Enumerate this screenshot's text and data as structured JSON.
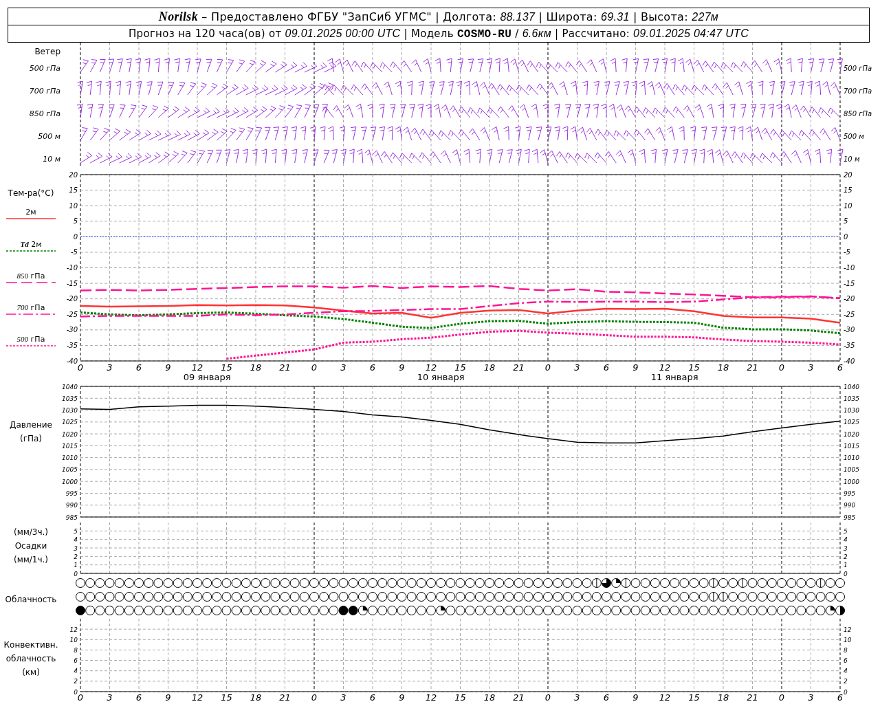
{
  "header": {
    "line_1": "**Norilsk** – Предоставлено ФГБУ \"ЗапСиб УГМС\" | Долгота: *88.137* | Широта: *69.31* | Высота: *227м*",
    "line_2": "Прогноз на 120 часа(ов) от *09.01.2025 00:00 UTC* | Модель **COSMO-RU** / *6.6км* | Рассчитано: *09.01.2025 04:47 UTC*"
  },
  "wind": {
    "title": "Ветер",
    "levels": [
      {
        "left": "500 гПа",
        "right": "500 гПа"
      },
      {
        "left": "700 гПа",
        "right": "700 гПа"
      },
      {
        "left": "850 гПа",
        "right": "850 гПа"
      },
      {
        "left": "500 м",
        "right": "500 м"
      },
      {
        "left": "10 м",
        "right": "10 м"
      }
    ]
  },
  "temperature": {
    "title": "Тем-ра(°C)",
    "dates": [
      "09 января",
      "10 января",
      "11 января"
    ],
    "right_ticks": [
      "20",
      "15",
      "10",
      "5",
      "0",
      "-5",
      "-10",
      "-15",
      "-20",
      "-25",
      "-30",
      "-35",
      "-40"
    ],
    "chart_data": {
      "type": "line",
      "categories": [
        "0",
        "3",
        "6",
        "9",
        "12",
        "15",
        "18",
        "21",
        "0",
        "3",
        "6",
        "9",
        "12",
        "15",
        "18",
        "21",
        "0",
        "3",
        "6",
        "9",
        "12",
        "15",
        "18",
        "21",
        "0",
        "3",
        "6"
      ],
      "ylim": [
        -40,
        20
      ],
      "yticks": [
        20,
        15,
        10,
        5,
        0,
        -5,
        -10,
        -15,
        -20,
        -25,
        -30,
        -35,
        -40
      ],
      "grid": true,
      "ref_lines": [
        {
          "axis": "y",
          "value": 0,
          "color": "#2040ff"
        }
      ],
      "series": [
        {
          "name": "2м",
          "line_style": "solid",
          "color": "#ff3333",
          "values": [
            -22.3,
            -22.5,
            -22.4,
            -22.3,
            -22,
            -22.1,
            -22,
            -22.1,
            -22.8,
            -23.8,
            -24.7,
            -24.5,
            -26.1,
            -24.5,
            -23.8,
            -23.6,
            -24.7,
            -23.8,
            -23.2,
            -23.3,
            -23.2,
            -24,
            -25.5,
            -26,
            -26,
            -26.4,
            -27.7
          ]
        },
        {
          "name": "**Td** 2м",
          "line_style": "dotted",
          "color": "#008000",
          "values": [
            -24.4,
            -25,
            -25.3,
            -25,
            -24.6,
            -24.4,
            -24.8,
            -25.3,
            -25.7,
            -26.5,
            -27.7,
            -29,
            -29.4,
            -28,
            -27.2,
            -27.1,
            -28,
            -27.5,
            -27.2,
            -27.4,
            -27.5,
            -27.7,
            -29.3,
            -29.8,
            -29.8,
            -30.2,
            -31.1
          ]
        },
        {
          "name": "*850* гПа",
          "line_style": "dashed",
          "color": "#ff1493",
          "values": [
            -17.3,
            -17.1,
            -17.3,
            -17.1,
            -16.8,
            -16.5,
            -16.2,
            -16,
            -16,
            -16.4,
            -15.9,
            -16.5,
            -16,
            -16.2,
            -15.9,
            -16.8,
            -17.3,
            -16.9,
            -17.7,
            -17.9,
            -18.3,
            -18.6,
            -19,
            -19.5,
            -19.3,
            -19.2,
            -19.8
          ]
        },
        {
          "name": "*700* гПа",
          "line_style": "dashdot",
          "color": "#ff1493",
          "values": [
            -25.7,
            -25.5,
            -25.5,
            -25.5,
            -25.5,
            -25,
            -25.3,
            -25,
            -24.5,
            -24,
            -23.9,
            -23.6,
            -23.3,
            -23.3,
            -22.3,
            -21.4,
            -20.9,
            -21,
            -20.9,
            -20.9,
            -21.1,
            -20.9,
            -20.2,
            -19.5,
            -19.5,
            -19.3,
            -19.8
          ]
        },
        {
          "name": "*500* гПа",
          "line_style": "dotted",
          "color": "#ff1493",
          "values": [
            null,
            null,
            null,
            null,
            null,
            -39.3,
            -38.3,
            -37.3,
            -36.3,
            -34.1,
            -33.8,
            -33,
            -32.5,
            -31.5,
            -30.6,
            -30.3,
            -30.9,
            -31.2,
            -31.7,
            -32.2,
            -32.2,
            -32.4,
            -33.1,
            -33.6,
            -33.8,
            -34.1,
            -34.7
          ]
        }
      ]
    }
  },
  "pressure": {
    "labels": [
      "Давление",
      "(гПа)"
    ],
    "right_ticks": [
      "1040",
      "1035",
      "1030",
      "1025",
      "1020",
      "1015",
      "1010",
      "1005",
      "1000",
      "995",
      "990",
      "985"
    ],
    "chart_data": {
      "type": "line",
      "categories": [
        null,
        null,
        null,
        null,
        null,
        null,
        null,
        null,
        null,
        null,
        null,
        null,
        null,
        null,
        null,
        null,
        null,
        null,
        null,
        null,
        null,
        null,
        null,
        null,
        null,
        null,
        null
      ],
      "ylim": [
        985,
        1040
      ],
      "yticks": [
        1040,
        1035,
        1030,
        1025,
        1020,
        1015,
        1010,
        1005,
        1000,
        995,
        990,
        985
      ],
      "grid": true,
      "series": [
        {
          "color": "#000000",
          "values": [
            1030.5,
            1030.3,
            1031.4,
            1031.7,
            1032,
            1032,
            1031.7,
            1031.1,
            1030.3,
            1029.4,
            1028,
            1027.1,
            1025.7,
            1024,
            1021.7,
            1019.7,
            1018,
            1016.5,
            1016.2,
            1016.2,
            1017.1,
            1018,
            1019.1,
            1020.9,
            1022.5,
            1024,
            1025.4
          ]
        }
      ]
    }
  },
  "precipitation": {
    "labels": [
      "(мм/3ч.)",
      "Осадки",
      "(мм/1ч.)"
    ],
    "right_ticks": [
      "5",
      "4",
      "3",
      "2",
      "1",
      "0"
    ],
    "chart_data": {
      "type": "bar",
      "categories": [
        null,
        null,
        null,
        null,
        null,
        null,
        null,
        null,
        null,
        null,
        null,
        null,
        null,
        null,
        null,
        null,
        null,
        null,
        null,
        null,
        null,
        null,
        null,
        null,
        null,
        null,
        null
      ],
      "ylim": [
        0,
        6
      ],
      "yticks": [
        5,
        4,
        3,
        2,
        1,
        0
      ],
      "grid": true,
      "values": [
        0,
        0,
        0,
        0,
        0,
        0,
        0,
        0,
        0,
        0,
        0,
        0,
        0,
        0,
        0,
        0,
        0,
        0,
        0,
        0,
        0,
        0,
        0,
        0,
        0,
        0,
        0
      ]
    }
  },
  "clouds": {
    "label": "Облачность",
    "rows": [
      {
        "cells": [
          {
            "kind": "clear"
          },
          {
            "kind": "clear"
          },
          {
            "kind": "clear"
          },
          {
            "kind": "clear"
          },
          {
            "kind": "clear"
          },
          {
            "kind": "clear"
          },
          {
            "kind": "clear"
          },
          {
            "kind": "clear"
          },
          {
            "kind": "clear"
          },
          {
            "kind": "clear"
          },
          {
            "kind": "clear"
          },
          {
            "kind": "clear"
          },
          {
            "kind": "clear"
          },
          {
            "kind": "clear"
          },
          {
            "kind": "clear"
          },
          {
            "kind": "clear"
          },
          {
            "kind": "clear"
          },
          {
            "kind": "clear"
          },
          {
            "kind": "clear"
          },
          {
            "kind": "clear"
          },
          {
            "kind": "clear"
          },
          {
            "kind": "clear"
          },
          {
            "kind": "clear"
          },
          {
            "kind": "clear"
          },
          {
            "kind": "clear"
          },
          {
            "kind": "clear"
          },
          {
            "kind": "clear"
          },
          {
            "kind": "clear"
          },
          {
            "kind": "clear"
          },
          {
            "kind": "clear"
          },
          {
            "kind": "clear"
          },
          {
            "kind": "clear"
          },
          {
            "kind": "clear"
          },
          {
            "kind": "clear"
          },
          {
            "kind": "clear"
          },
          {
            "kind": "clear"
          },
          {
            "kind": "clear"
          },
          {
            "kind": "clear"
          },
          {
            "kind": "clear"
          },
          {
            "kind": "clear"
          },
          {
            "kind": "clear"
          },
          {
            "kind": "clear"
          },
          {
            "kind": "clear"
          },
          {
            "kind": "clear"
          },
          {
            "kind": "clear"
          },
          {
            "kind": "clear"
          },
          {
            "kind": "clear"
          },
          {
            "kind": "clear"
          },
          {
            "kind": "clear"
          },
          {
            "kind": "clear"
          },
          {
            "kind": "clear"
          },
          {
            "kind": "clear"
          },
          {
            "kind": "clear"
          },
          {
            "kind": "trace"
          },
          {
            "kind": "three_quarters"
          },
          {
            "kind": "quarter"
          },
          {
            "kind": "trace"
          },
          {
            "kind": "clear"
          },
          {
            "kind": "clear"
          },
          {
            "kind": "clear"
          },
          {
            "kind": "clear"
          },
          {
            "kind": "clear"
          },
          {
            "kind": "clear"
          },
          {
            "kind": "clear"
          },
          {
            "kind": "clear"
          },
          {
            "kind": "trace"
          },
          {
            "kind": "clear"
          },
          {
            "kind": "clear"
          },
          {
            "kind": "trace"
          },
          {
            "kind": "clear"
          },
          {
            "kind": "clear"
          },
          {
            "kind": "clear"
          },
          {
            "kind": "clear"
          },
          {
            "kind": "clear"
          },
          {
            "kind": "clear"
          },
          {
            "kind": "clear"
          },
          {
            "kind": "trace"
          },
          {
            "kind": "clear"
          },
          {
            "kind": "clear"
          }
        ]
      },
      {
        "cells": [
          {
            "kind": "clear"
          },
          {
            "kind": "clear"
          },
          {
            "kind": "clear"
          },
          {
            "kind": "clear"
          },
          {
            "kind": "clear"
          },
          {
            "kind": "clear"
          },
          {
            "kind": "clear"
          },
          {
            "kind": "clear"
          },
          {
            "kind": "clear"
          },
          {
            "kind": "clear"
          },
          {
            "kind": "clear"
          },
          {
            "kind": "clear"
          },
          {
            "kind": "clear"
          },
          {
            "kind": "clear"
          },
          {
            "kind": "clear"
          },
          {
            "kind": "clear"
          },
          {
            "kind": "clear"
          },
          {
            "kind": "clear"
          },
          {
            "kind": "clear"
          },
          {
            "kind": "clear"
          },
          {
            "kind": "clear"
          },
          {
            "kind": "clear"
          },
          {
            "kind": "clear"
          },
          {
            "kind": "clear"
          },
          {
            "kind": "clear"
          },
          {
            "kind": "clear"
          },
          {
            "kind": "clear"
          },
          {
            "kind": "clear"
          },
          {
            "kind": "clear"
          },
          {
            "kind": "clear"
          },
          {
            "kind": "clear"
          },
          {
            "kind": "clear"
          },
          {
            "kind": "clear"
          },
          {
            "kind": "clear"
          },
          {
            "kind": "clear"
          },
          {
            "kind": "clear"
          },
          {
            "kind": "clear"
          },
          {
            "kind": "clear"
          },
          {
            "kind": "clear"
          },
          {
            "kind": "clear"
          },
          {
            "kind": "clear"
          },
          {
            "kind": "clear"
          },
          {
            "kind": "clear"
          },
          {
            "kind": "clear"
          },
          {
            "kind": "clear"
          },
          {
            "kind": "clear"
          },
          {
            "kind": "clear"
          },
          {
            "kind": "clear"
          },
          {
            "kind": "clear"
          },
          {
            "kind": "clear"
          },
          {
            "kind": "clear"
          },
          {
            "kind": "clear"
          },
          {
            "kind": "clear"
          },
          {
            "kind": "clear"
          },
          {
            "kind": "clear"
          },
          {
            "kind": "clear"
          },
          {
            "kind": "clear"
          },
          {
            "kind": "clear"
          },
          {
            "kind": "clear"
          },
          {
            "kind": "clear"
          },
          {
            "kind": "clear"
          },
          {
            "kind": "clear"
          },
          {
            "kind": "clear"
          },
          {
            "kind": "clear"
          },
          {
            "kind": "clear"
          },
          {
            "kind": "trace"
          },
          {
            "kind": "trace"
          },
          {
            "kind": "clear"
          },
          {
            "kind": "clear"
          },
          {
            "kind": "clear"
          },
          {
            "kind": "clear"
          },
          {
            "kind": "clear"
          },
          {
            "kind": "clear"
          },
          {
            "kind": "clear"
          },
          {
            "kind": "clear"
          },
          {
            "kind": "clear"
          },
          {
            "kind": "clear"
          },
          {
            "kind": "clear"
          },
          {
            "kind": "clear"
          }
        ]
      },
      {
        "cells": [
          {
            "kind": "overcast"
          },
          {
            "kind": "clear"
          },
          {
            "kind": "clear"
          },
          {
            "kind": "clear"
          },
          {
            "kind": "clear"
          },
          {
            "kind": "clear"
          },
          {
            "kind": "clear"
          },
          {
            "kind": "clear"
          },
          {
            "kind": "clear"
          },
          {
            "kind": "clear"
          },
          {
            "kind": "clear"
          },
          {
            "kind": "clear"
          },
          {
            "kind": "clear"
          },
          {
            "kind": "clear"
          },
          {
            "kind": "clear"
          },
          {
            "kind": "clear"
          },
          {
            "kind": "clear"
          },
          {
            "kind": "clear"
          },
          {
            "kind": "clear"
          },
          {
            "kind": "clear"
          },
          {
            "kind": "clear"
          },
          {
            "kind": "clear"
          },
          {
            "kind": "clear"
          },
          {
            "kind": "clear"
          },
          {
            "kind": "clear"
          },
          {
            "kind": "clear"
          },
          {
            "kind": "clear"
          },
          {
            "kind": "overcast"
          },
          {
            "kind": "overcast"
          },
          {
            "kind": "quarter"
          },
          {
            "kind": "clear"
          },
          {
            "kind": "clear"
          },
          {
            "kind": "clear"
          },
          {
            "kind": "clear"
          },
          {
            "kind": "clear"
          },
          {
            "kind": "clear"
          },
          {
            "kind": "clear"
          },
          {
            "kind": "quarter"
          },
          {
            "kind": "clear"
          },
          {
            "kind": "clear"
          },
          {
            "kind": "clear"
          },
          {
            "kind": "clear"
          },
          {
            "kind": "clear"
          },
          {
            "kind": "clear"
          },
          {
            "kind": "clear"
          },
          {
            "kind": "clear"
          },
          {
            "kind": "clear"
          },
          {
            "kind": "clear"
          },
          {
            "kind": "clear"
          },
          {
            "kind": "clear"
          },
          {
            "kind": "clear"
          },
          {
            "kind": "clear"
          },
          {
            "kind": "clear"
          },
          {
            "kind": "clear"
          },
          {
            "kind": "clear"
          },
          {
            "kind": "clear"
          },
          {
            "kind": "clear"
          },
          {
            "kind": "clear"
          },
          {
            "kind": "clear"
          },
          {
            "kind": "clear"
          },
          {
            "kind": "clear"
          },
          {
            "kind": "clear"
          },
          {
            "kind": "clear"
          },
          {
            "kind": "clear"
          },
          {
            "kind": "clear"
          },
          {
            "kind": "clear"
          },
          {
            "kind": "clear"
          },
          {
            "kind": "clear"
          },
          {
            "kind": "clear"
          },
          {
            "kind": "clear"
          },
          {
            "kind": "clear"
          },
          {
            "kind": "clear"
          },
          {
            "kind": "clear"
          },
          {
            "kind": "clear"
          },
          {
            "kind": "clear"
          },
          {
            "kind": "clear"
          },
          {
            "kind": "clear"
          },
          {
            "kind": "quarter"
          },
          {
            "kind": "half"
          }
        ]
      }
    ]
  },
  "convective": {
    "labels": [
      "Конвективн.",
      "облачность",
      "(км)"
    ],
    "right_ticks": [
      "12",
      "10",
      "8",
      "6",
      "4",
      "2",
      "0"
    ],
    "chart_data": {
      "type": "bar",
      "categories": [
        "0",
        "3",
        "6",
        "9",
        "12",
        "15",
        "18",
        "21",
        "0",
        "3",
        "6",
        "9",
        "12",
        "15",
        "18",
        "21",
        "0",
        "3",
        "6",
        "9",
        "12",
        "15",
        "18",
        "21",
        "0",
        "3",
        "6"
      ],
      "ylim": [
        0,
        14
      ],
      "yticks": [
        12,
        10,
        8,
        6,
        4,
        2,
        0
      ],
      "grid": true,
      "values": [
        0,
        0,
        0,
        0,
        0,
        0,
        0,
        0,
        0,
        0,
        0,
        0,
        0,
        0,
        0,
        0,
        0,
        0,
        0,
        0,
        0,
        0,
        0,
        0,
        0,
        0,
        0
      ]
    }
  }
}
